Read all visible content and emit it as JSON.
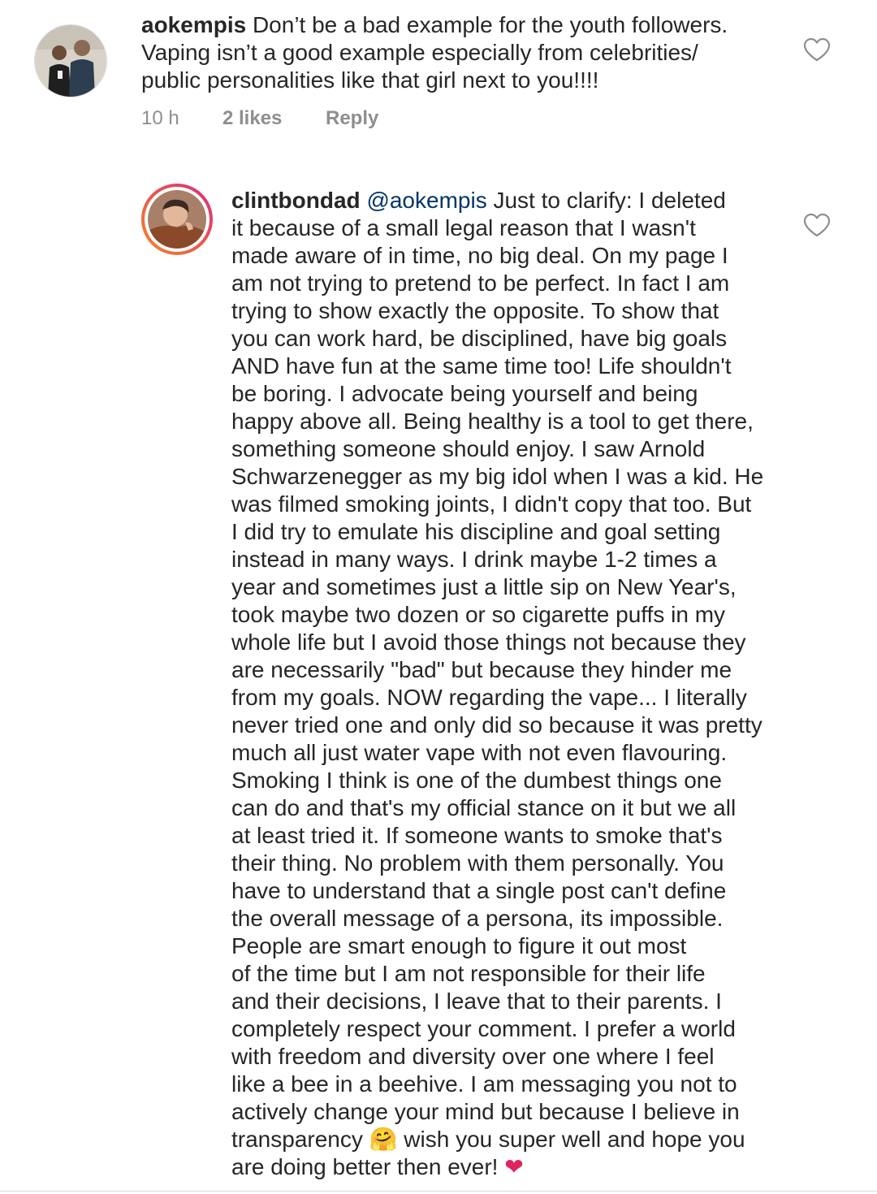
{
  "comments": [
    {
      "username": "aokempis",
      "text": " Don’t be a bad example for the youth followers.\nVaping isn’t a good example especially from celebrities/\npublic personalities like that girl next to you!!!!",
      "time": "10 h",
      "likes": "2 likes",
      "reply_label": "Reply"
    },
    {
      "username": "clintbondad",
      "mention": "@aokempis",
      "text_lines": [
        " Just to clarify: I deleted",
        "it because of a small legal reason that I wasn't",
        "made aware of in time, no big deal. On my page I",
        "am not trying to pretend to be perfect. In fact I am",
        "trying to show exactly the opposite. To show that",
        "you can work hard, be disciplined, have big goals",
        "AND have fun at the same time too! Life shouldn't",
        "be boring. I advocate being yourself and being",
        "happy above all. Being healthy is a tool to get there,",
        "something someone should enjoy. I saw Arnold",
        "Schwarzenegger as my big idol when I was a kid. He",
        "was filmed smoking joints, I didn't copy that too. But",
        "I did try to emulate his discipline and goal setting",
        "instead in many ways. I drink maybe 1-2 times a",
        "year and sometimes just a little sip on New Year's,",
        "took maybe two dozen or so cigarette puffs in my",
        "whole life but I avoid those things not because they",
        "are necessarily \"bad\" but because they hinder me",
        "from my goals. NOW regarding the vape... I literally",
        "never tried one and only did so because it was pretty",
        "much all just water vape with not even flavouring.",
        "Smoking I think is one of the dumbest things one",
        "can do and that's my official stance on it but we all",
        "at least tried it. If someone wants to smoke that's",
        "their thing. No problem with them personally. You",
        "have to understand that a single post can't define",
        "the overall message of a persona, its impossible.",
        "People are smart enough to figure it out most",
        "of the time but I am not responsible for their life",
        "and their decisions, I leave that to their parents. I",
        "completely respect your comment. I prefer a world",
        "with freedom and diversity over one where I feel",
        "like a bee in a beehive. I am messaging you not to",
        "actively change your mind but because I believe in"
      ],
      "line_before_emoji": "transparency ",
      "emoji_hug": "🤗",
      "line_after_emoji": " wish you super well and hope you",
      "last_line": "are doing better then ever! ",
      "emoji_heart": "❤"
    }
  ],
  "icons": {
    "like": "heart-outline-icon"
  },
  "colors": {
    "text": "#262626",
    "muted": "#8e8e8e",
    "mention": "#003569",
    "heart_emoji": "#e0245e",
    "story_ring_start": "#f58529",
    "story_ring_end": "#dd2a7b"
  }
}
